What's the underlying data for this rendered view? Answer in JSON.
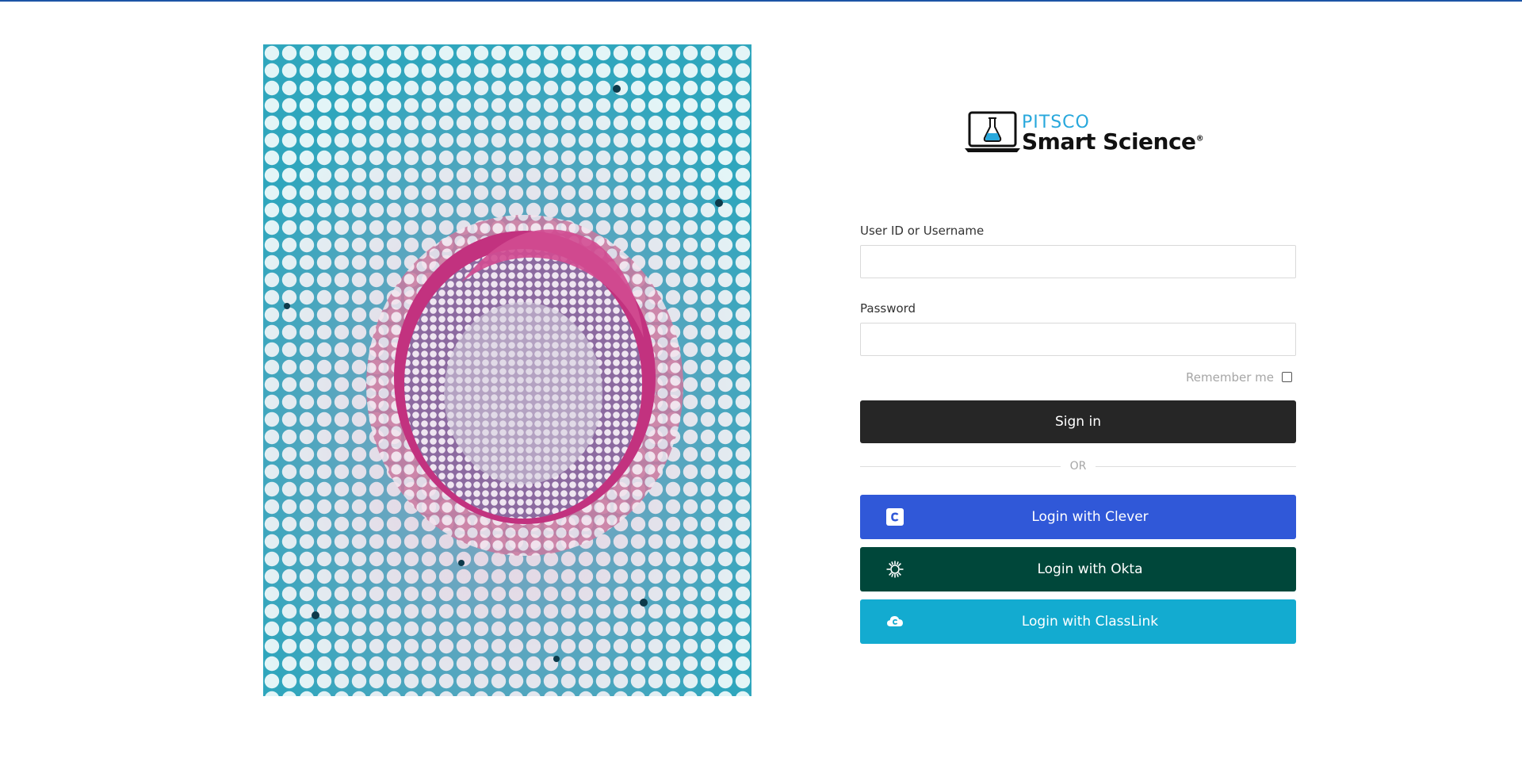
{
  "brand": {
    "company": "PITSCO",
    "product": "Smart Science",
    "registered_mark": "®"
  },
  "hero_image": {
    "icon": "plant-stem-cross-section-micrograph"
  },
  "form": {
    "username_label": "User ID or Username",
    "username_value": "",
    "password_label": "Password",
    "password_value": "",
    "remember_label": "Remember me",
    "remember_checked": false,
    "signin_label": "Sign in",
    "divider_text": "OR"
  },
  "sso": {
    "clever": {
      "label": "Login with Clever",
      "icon": "clever-icon",
      "color": "#3058d8"
    },
    "okta": {
      "label": "Login with Okta",
      "icon": "okta-icon",
      "color": "#00473a"
    },
    "classlink": {
      "label": "Login with ClassLink",
      "icon": "classlink-icon",
      "color": "#13abd0"
    }
  },
  "colors": {
    "top_rule": "#1c54a6",
    "signin": "#262626",
    "brand_blue": "#28a8dc"
  }
}
